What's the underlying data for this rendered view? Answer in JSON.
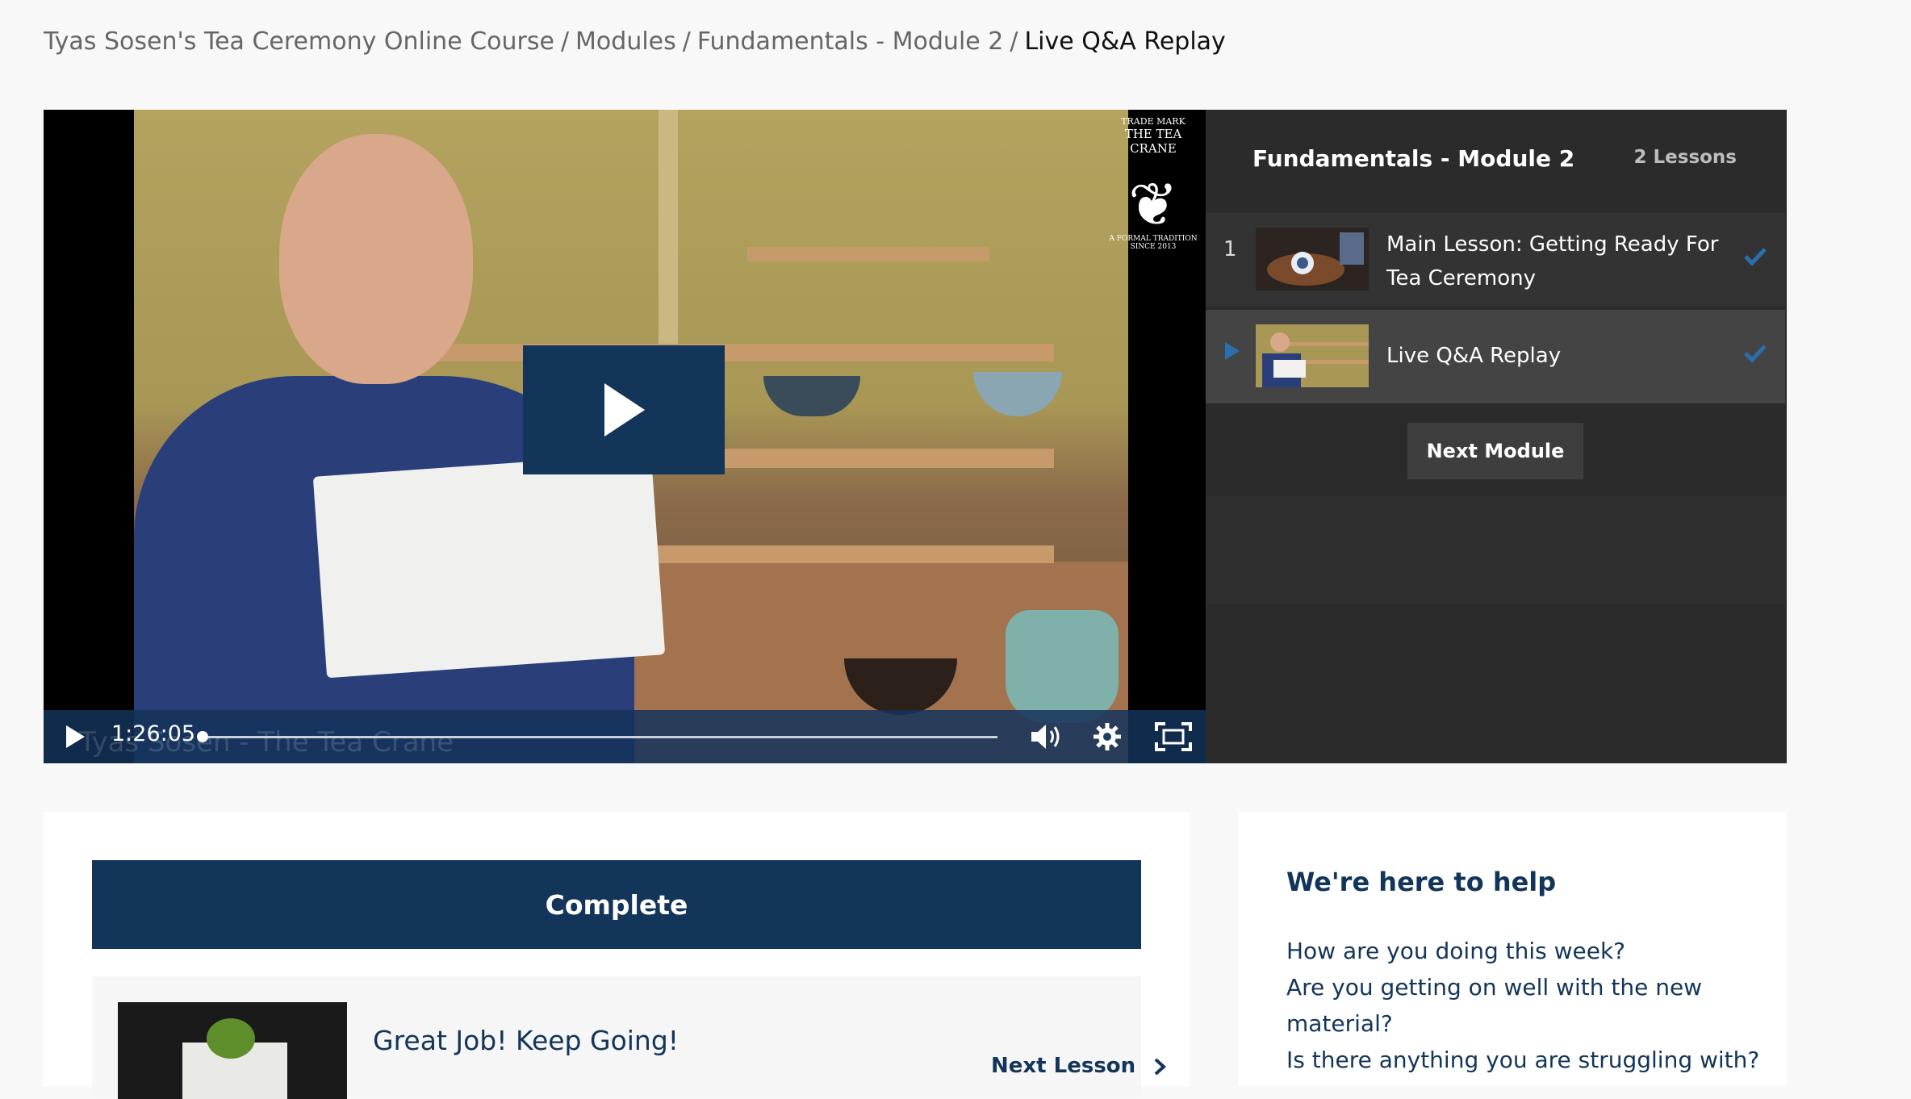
{
  "breadcrumb": {
    "course": "Tyas Sosen's Tea Ceremony Online Course",
    "modules": "Modules",
    "module": "Fundamentals - Module 2",
    "current": "Live Q&A Replay",
    "separator": "/"
  },
  "video": {
    "time": "1:26:05",
    "progress": 0.01,
    "caption": "Tyas Sosen - The Tea Crane",
    "logo_top": "TRADE MARK",
    "logo_name": "THE TEA CRANE",
    "logo_sub": "A FORMAL TRADITION SINCE 2013",
    "icons": [
      "play-icon",
      "volume-icon",
      "settings-gear-icon",
      "fullscreen-icon"
    ]
  },
  "panel": {
    "title": "Fundamentals - Module 2",
    "count": "2 Lessons",
    "lessons": [
      {
        "number": "1",
        "title": "Main Lesson: Getting Ready For Tea Ceremony",
        "completed": true
      },
      {
        "number": "",
        "title": "Live Q&A Replay",
        "completed": true,
        "active": true
      }
    ],
    "next_module": "Next Module"
  },
  "main": {
    "complete_label": "Complete",
    "next_message": "Great Job! Keep Going!",
    "next_lesson_label": "Next Lesson"
  },
  "help": {
    "title": "We're here to help",
    "lines": [
      "How are you doing this week?",
      "Are you getting on well with the new material?",
      "Is there anything you are struggling with?"
    ]
  },
  "colors": {
    "primary": "#13355a",
    "panel_bg": "#2b2b2b",
    "check": "#2a6fb0"
  }
}
